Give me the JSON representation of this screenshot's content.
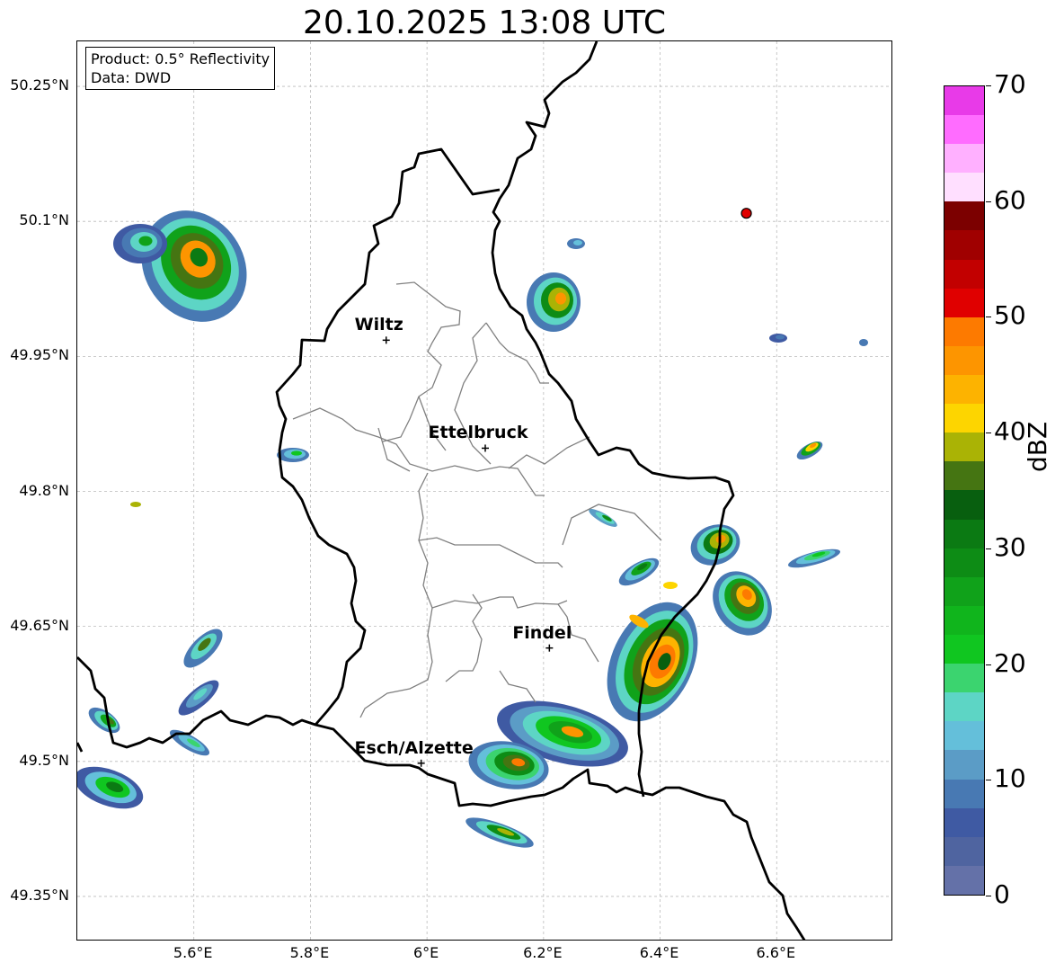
{
  "title": "20.10.2025 13:08 UTC",
  "info_box": {
    "product": "Product: 0.5° Reflectivity",
    "source": "Data: DWD"
  },
  "map": {
    "extent": {
      "lon": [
        5.4,
        6.8
      ],
      "lat": [
        49.3,
        50.3
      ]
    },
    "lat_ticks": [
      {
        "value": 50.25,
        "label": "50.25°N"
      },
      {
        "value": 50.1,
        "label": "50.1°N"
      },
      {
        "value": 49.95,
        "label": "49.95°N"
      },
      {
        "value": 49.8,
        "label": "49.8°N"
      },
      {
        "value": 49.65,
        "label": "49.65°N"
      },
      {
        "value": 49.5,
        "label": "49.5°N"
      },
      {
        "value": 49.35,
        "label": "49.35°N"
      }
    ],
    "lon_ticks": [
      {
        "value": 5.6,
        "label": "5.6°E"
      },
      {
        "value": 5.8,
        "label": "5.8°E"
      },
      {
        "value": 6.0,
        "label": "6°E"
      },
      {
        "value": 6.2,
        "label": "6.2°E"
      },
      {
        "value": 6.4,
        "label": "6.4°E"
      },
      {
        "value": 6.6,
        "label": "6.6°E"
      }
    ],
    "cities": [
      {
        "name": "Wiltz",
        "lon": 5.93,
        "lat": 49.968
      },
      {
        "name": "Ettelbruck",
        "lon": 6.1,
        "lat": 49.848
      },
      {
        "name": "Findel",
        "lon": 6.21,
        "lat": 49.626
      },
      {
        "name": "Esch/Alzette",
        "lon": 5.99,
        "lat": 49.498
      }
    ],
    "radar_site": {
      "lon": 6.548,
      "lat": 50.109,
      "color": "#e00000"
    },
    "border_color": "#000000",
    "canton_color": "#808080",
    "grid_color": "#bbbbbb"
  },
  "colorbar": {
    "label": "dBZ",
    "min": 0,
    "max": 70,
    "ticks": [
      "0",
      "10",
      "20",
      "30",
      "40",
      "50",
      "60",
      "70"
    ],
    "colors": [
      "#6471a8",
      "#4f64a0",
      "#3f5aa3",
      "#4879b3",
      "#5b9cc6",
      "#64bfda",
      "#5dd5c5",
      "#3bd46f",
      "#10c620",
      "#10b51c",
      "#10a21a",
      "#0d8c15",
      "#0b7a13",
      "#085f0f",
      "#457512",
      "#aab305",
      "#fdd500",
      "#fdb300",
      "#fd9500",
      "#fd7a00",
      "#e00000",
      "#c20000",
      "#a00000",
      "#7c0000",
      "#ffdfff",
      "#ffb0ff",
      "#ff6cff",
      "#e83ae8"
    ]
  }
}
